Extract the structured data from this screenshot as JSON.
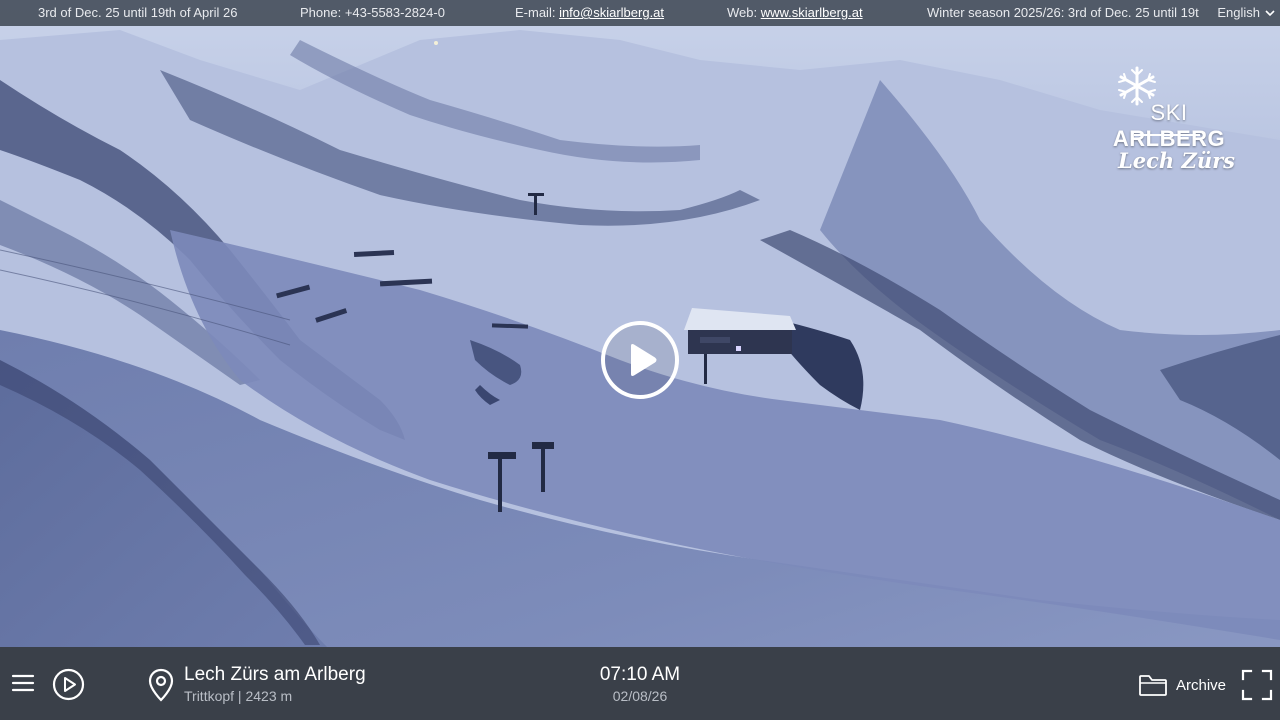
{
  "topbar": {
    "season_dates": "3rd of Dec. 25 until 19th of April 26",
    "phone_label": "Phone: ",
    "phone_value": "+43-5583-2824-0",
    "email_label": "E-mail: ",
    "email_link": "info@skiarlberg.at",
    "web_label": "Web: ",
    "web_link": "www.skiarlberg.at",
    "winter_season": "Winter season 2025/26: 3rd of Dec. 25 until 19t",
    "language": "English"
  },
  "logo": {
    "ski": "SKI",
    "arlberg": "ARLBERG",
    "subtitle": "Lech Zürs"
  },
  "bottombar": {
    "location_title": "Lech Zürs am Arlberg",
    "location_sub": "Trittkopf | 2423 m",
    "time": "07:10 AM",
    "date": "02/08/26",
    "archive_label": "Archive"
  },
  "colors": {
    "topbar_bg": "#303842",
    "bottombar_bg": "#3a4049",
    "snow_light": "#c7d2ea",
    "snow_mid": "#8e9cc4",
    "snow_dark": "#4e5d88"
  },
  "icons": {
    "menu": "hamburger-icon",
    "play": "play-icon",
    "location": "map-pin-icon",
    "archive": "folder-icon",
    "fullscreen": "fullscreen-icon",
    "language": "chevron-down-icon"
  }
}
